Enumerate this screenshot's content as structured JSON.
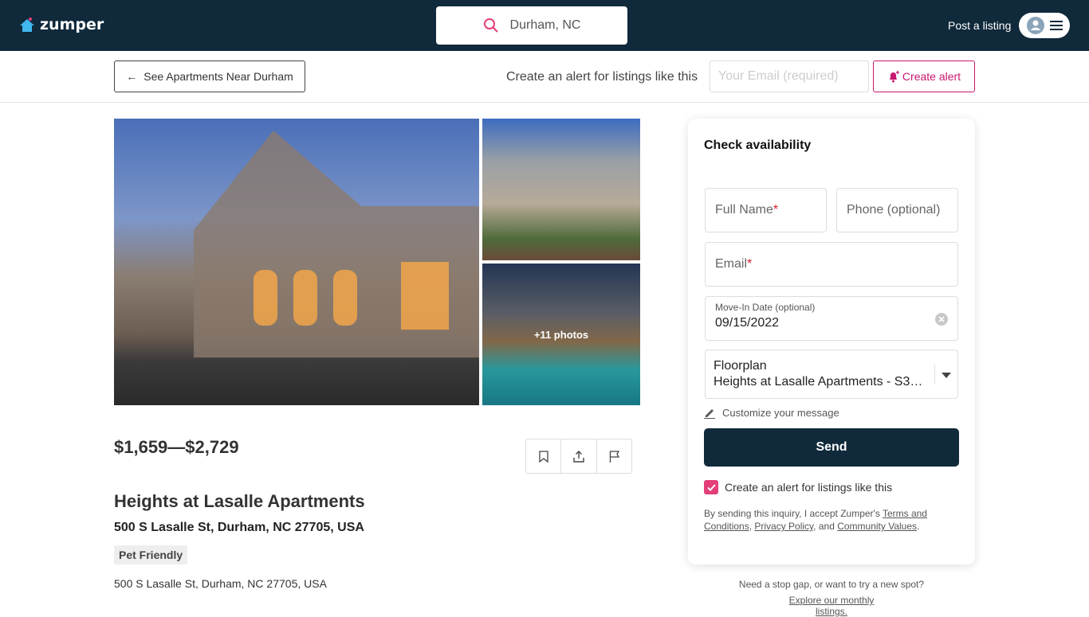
{
  "header": {
    "brand": "zumper",
    "search_value": "Durham, NC",
    "post_listing": "Post a listing"
  },
  "subbar": {
    "back_label": "See Apartments Near Durham",
    "alert_text": "Create an alert for listings like this",
    "email_placeholder": "Your Email (required)",
    "create_alert": "Create alert"
  },
  "photos": {
    "more_label": "+11 photos"
  },
  "listing": {
    "price": "$1,659—$2,729",
    "title": "Heights at Lasalle Apartments",
    "address": "500 S Lasalle St, Durham, NC 27705, USA",
    "badge": "Pet Friendly",
    "address_secondary": "500 S Lasalle St, Durham, NC 27705, USA"
  },
  "form": {
    "title": "Check availability",
    "full_name": "Full Name",
    "required_mark": "*",
    "phone": "Phone (optional)",
    "email": "Email",
    "move_in_label": "Move-In Date (optional)",
    "move_in_value": "09/15/2022",
    "floorplan_label": "Floorplan",
    "floorplan_value": "Heights at Lasalle Apartments - S3 · …",
    "customize": "Customize your message",
    "send": "Send",
    "alert_checkbox": "Create an alert for listings like this",
    "alert_checked": true,
    "legal_prefix": "By sending this inquiry, I accept Zumper's ",
    "terms": "Terms and Conditions",
    "comma": ", ",
    "privacy": "Privacy Policy",
    "and": ", and ",
    "community": "Community Values",
    "period": "."
  },
  "footer": {
    "question": "Need a stop gap, or want to try a new spot?",
    "link": "Explore our monthly listings."
  },
  "colors": {
    "header_bg": "#10293b",
    "accent": "#c8176f",
    "checkbox": "#e33e7a"
  }
}
